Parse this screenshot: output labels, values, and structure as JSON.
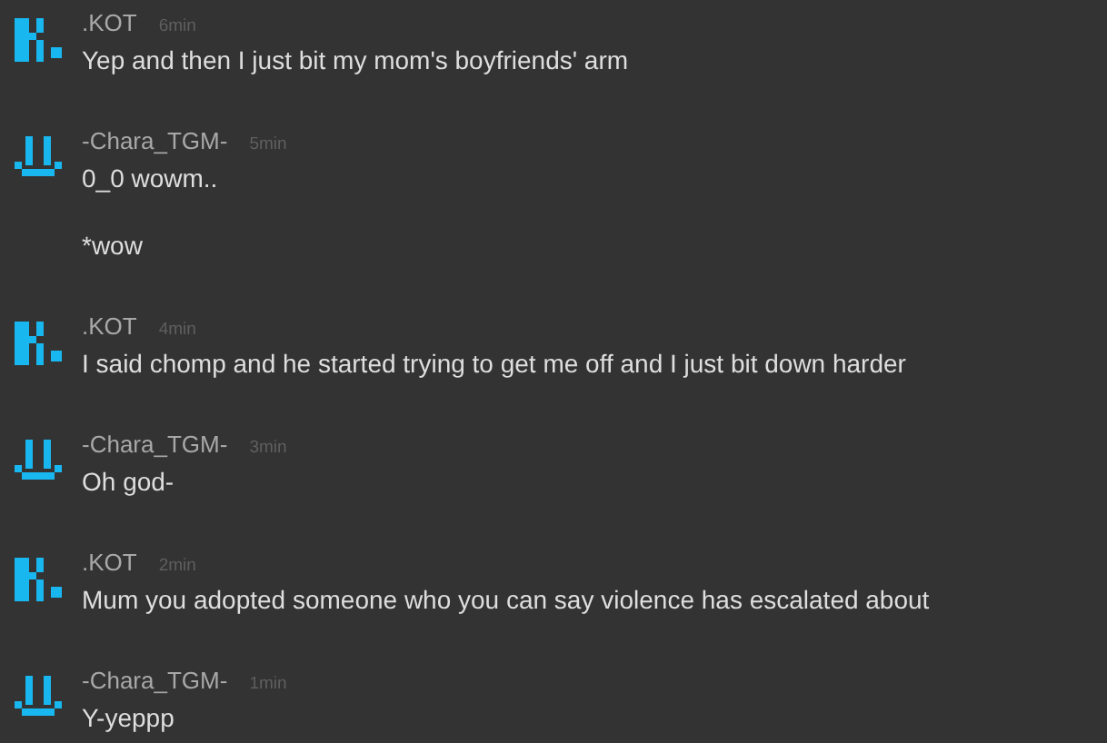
{
  "messages": [
    {
      "kind": "k",
      "author": ".KOT",
      "time": "6min",
      "lines": [
        "Yep and then I just bit my mom's boyfriends' arm"
      ]
    },
    {
      "kind": "smile",
      "author": "-Chara_TGM-",
      "time": "5min",
      "lines": [
        "0_0 wowm..",
        "*wow"
      ]
    },
    {
      "kind": "k",
      "author": ".KOT",
      "time": "4min",
      "lines": [
        "I said chomp and he started trying to get me off and I just bit down harder"
      ]
    },
    {
      "kind": "smile",
      "author": "-Chara_TGM-",
      "time": "3min",
      "lines": [
        "Oh god-"
      ]
    },
    {
      "kind": "k",
      "author": ".KOT",
      "time": "2min",
      "lines": [
        "Mum you adopted someone who you can say violence has escalated about"
      ]
    },
    {
      "kind": "smile",
      "author": "-Chara_TGM-",
      "time": "1min",
      "lines": [
        "Y-yeppp"
      ]
    }
  ]
}
